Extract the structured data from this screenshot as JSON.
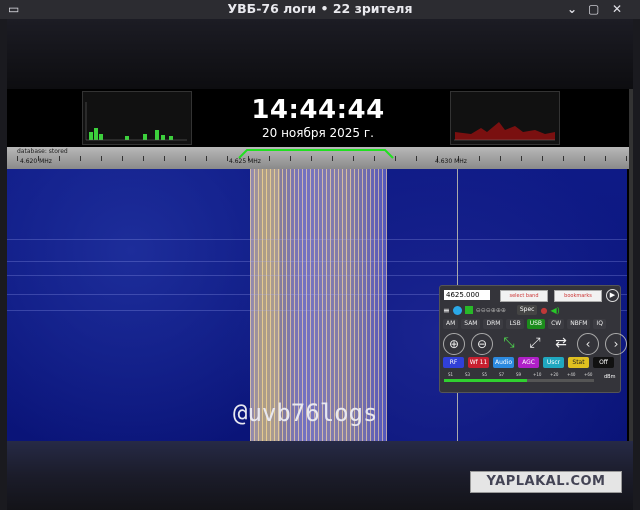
{
  "window": {
    "title": "УВБ-76 логи • 22 зрителя"
  },
  "clock": {
    "time": "14:44:44",
    "date": "20 ноября 2025 г."
  },
  "ruler": {
    "database": "database: stored",
    "labels": [
      "4.620 MHz",
      "4.625 MHz",
      "4.630 MHz"
    ]
  },
  "watermark": {
    "text": "@uvb76logs"
  },
  "panel": {
    "frequency": "4625.000",
    "select_left": "select band",
    "select_right": "bookmarks",
    "spec": "Spec",
    "modes": [
      "AM",
      "SAM",
      "DRM",
      "LSB",
      "USB",
      "CW",
      "NBFM",
      "IQ"
    ],
    "controls": [
      {
        "label": "RF",
        "color": "#3040d8"
      },
      {
        "label": "Wf 11",
        "color": "#c82030"
      },
      {
        "label": "Audio",
        "color": "#2c8ae0"
      },
      {
        "label": "AGC",
        "color": "#b020c8"
      },
      {
        "label": "Uscr",
        "color": "#20a8c0"
      },
      {
        "label": "Stat",
        "color": "#e0c020"
      },
      {
        "label": "Off",
        "color": "#111111"
      }
    ],
    "smeter_labels": [
      "S1",
      "S3",
      "S5",
      "S7",
      "S9",
      "+10",
      "+20",
      "+40",
      "+60"
    ],
    "smeter_level": 0.55,
    "smeter_unit": "dBm"
  },
  "logo": {
    "text": "YAPLAKAL.COM"
  }
}
